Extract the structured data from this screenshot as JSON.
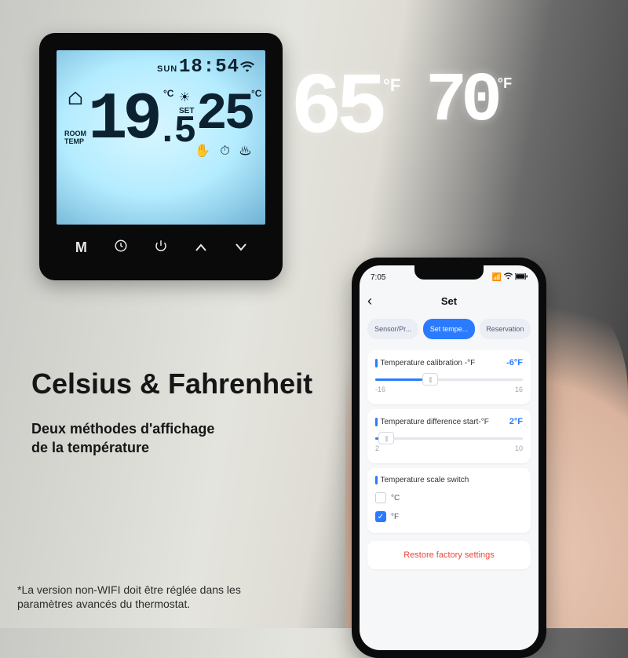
{
  "thermostat": {
    "day": "SUN",
    "clock": "18:54",
    "room_label": "ROOM\nTEMP",
    "room_temp_int": "19",
    "room_temp_dec": ".5",
    "unit_c": "°C",
    "set_label": "SET",
    "set_temp": "25",
    "buttons": {
      "mode": "M"
    }
  },
  "projection": {
    "room_f": "65",
    "set_f": "70",
    "unit_f": "°F"
  },
  "headline": "Celsius & Fahrenheit",
  "subtitle_l1": "Deux méthodes d'affichage",
  "subtitle_l2": "de la température",
  "footnote_l1": "*La version non-WIFI doit être réglée dans les",
  "footnote_l2": "paramètres avancés du thermostat.",
  "phone": {
    "status_time": "7:05",
    "nav_title": "Set",
    "tabs": {
      "t1": "Sensor/Pr...",
      "t2": "Set tempe...",
      "t3": "Reservation"
    },
    "card1": {
      "label": "Temperature calibration -°F",
      "value": "-6°F",
      "min": "-16",
      "max": "16",
      "fill_pct": 32,
      "thumb_pct": 32
    },
    "card2": {
      "label": "Temperature difference start-°F",
      "value": "2°F",
      "min": "2",
      "max": "10",
      "fill_pct": 2,
      "thumb_pct": 2
    },
    "card3": {
      "label": "Temperature scale switch",
      "opt_c": "°C",
      "opt_f": "°F"
    },
    "restore": "Restore factory settings"
  }
}
